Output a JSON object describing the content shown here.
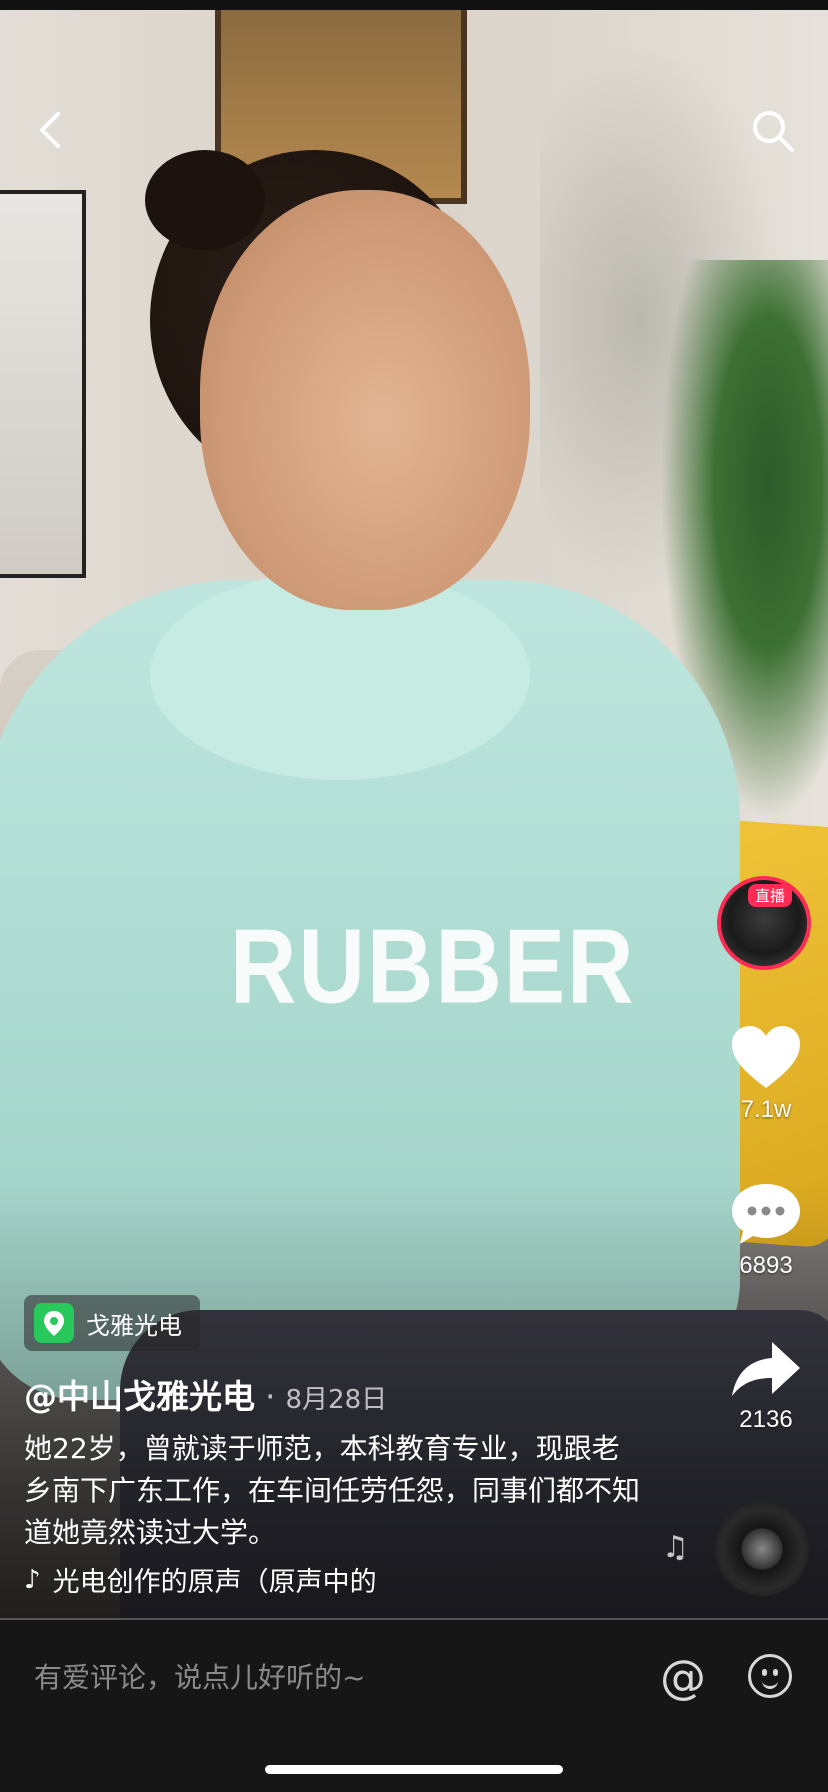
{
  "video": {
    "shirt_text": "RUBBER"
  },
  "right_rail": {
    "live_badge": "直播",
    "likes": "7.1w",
    "comments": "6893",
    "shares": "2136"
  },
  "caption": {
    "poi_label": "戈雅光电",
    "author": "@中山戈雅光电",
    "separator": "·",
    "date": "8月28日",
    "description": "她22岁，曾就读于师范，本科教育专业，现跟老乡南下广东工作，在车间任劳任怨，同事们都不知道她竟然读过大学。",
    "music": "光电创作的原声（原声中的"
  },
  "comment_bar": {
    "placeholder": "有爱评论，说点儿好听的~"
  },
  "icons": [
    "back-arrow-icon",
    "search-icon",
    "heart-icon",
    "comment-icon",
    "share-icon",
    "tiktok-note-icon",
    "location-icon",
    "at-icon",
    "emoji-icon"
  ]
}
